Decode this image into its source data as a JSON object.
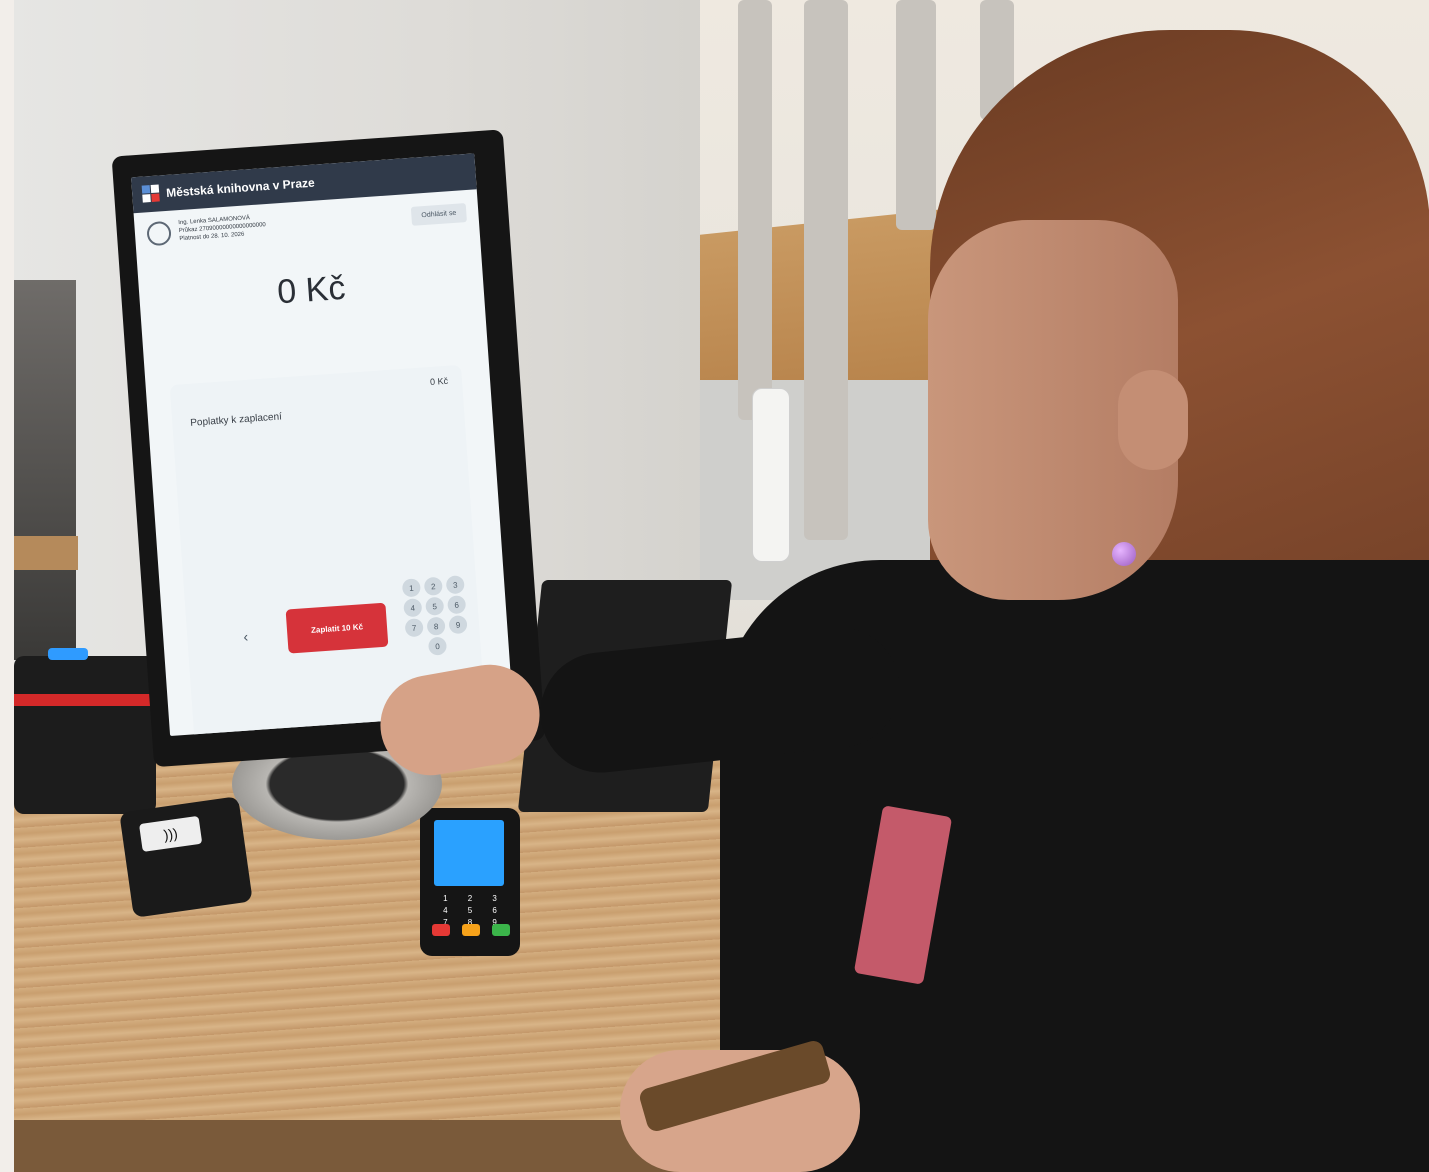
{
  "kiosk": {
    "brand": "Městská knihovna v Praze",
    "user": {
      "name": "Ing. Lenka SALAMONOVÁ",
      "line2": "Průkaz 27090000000000000000",
      "line3": "Platnost do 28. 10. 2026"
    },
    "logout_label": "Odhlásit se",
    "amount_label": "0 Kč",
    "fees": {
      "label": "Poplatky k zaplacení",
      "amount": "0 Kč"
    },
    "pay_button_label": "Zaplatit 10 Kč",
    "back_label": "‹",
    "keypad": [
      "1",
      "2",
      "3",
      "4",
      "5",
      "6",
      "7",
      "8",
      "9",
      "0"
    ]
  },
  "devices": {
    "terminal_keys": [
      "1",
      "2",
      "3",
      "4",
      "5",
      "6",
      "7",
      "8",
      "9"
    ]
  },
  "colors": {
    "topbar": "#303a4a",
    "pay_button": "#d6333a",
    "screen_bg": "#f2f6f8"
  }
}
